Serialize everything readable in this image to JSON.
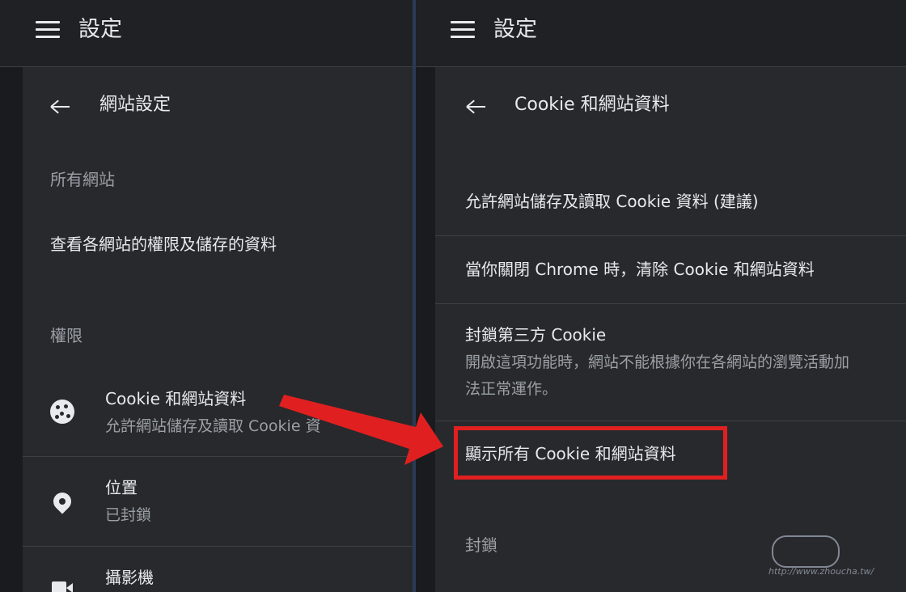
{
  "left": {
    "appbar_title": "設定",
    "header_title": "網站設定",
    "all_sites_label": "所有網站",
    "all_sites_item": "查看各網站的權限及儲存的資料",
    "permissions_label": "權限",
    "items": [
      {
        "title": "Cookie 和網站資料",
        "subtitle": "允許網站儲存及讀取 Cookie 資",
        "icon": "cookie-icon"
      },
      {
        "title": "位置",
        "subtitle": "已封鎖",
        "icon": "location-pin-icon"
      },
      {
        "title": "攝影機",
        "subtitle": "",
        "icon": "videocam-icon"
      }
    ]
  },
  "right": {
    "appbar_title": "設定",
    "header_title": "Cookie 和網站資料",
    "options": [
      {
        "label": "允許網站儲存及讀取 Cookie 資料 (建議)"
      },
      {
        "label": "當你關閉 Chrome 時，清除 Cookie 和網站資料"
      },
      {
        "label": "封鎖第三方 Cookie",
        "description_line1": "開啟這項功能時，網站不能根據你在各網站的瀏覽活動加",
        "description_line2": "法正常運作。"
      }
    ],
    "see_all_label": "顯示所有 Cookie 和網站資料",
    "blocked_label": "封鎖"
  },
  "colors": {
    "background": "#202124",
    "content": "#28292c",
    "text": "#e8eaed",
    "secondary_text": "#9aa0a6",
    "annotation_red": "#e02020"
  },
  "watermark": {
    "url": "http://www.zhoucha.tw/"
  }
}
